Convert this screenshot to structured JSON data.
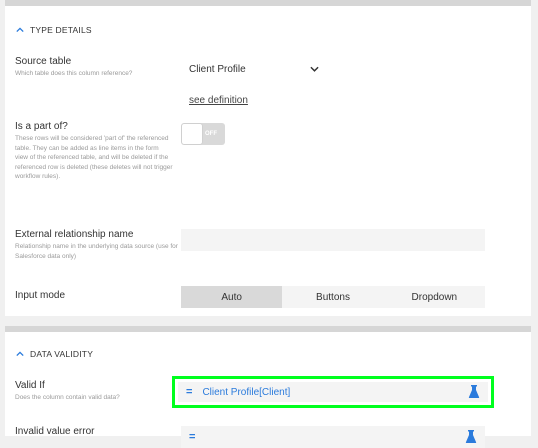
{
  "type_details": {
    "header": "TYPE DETAILS",
    "source_table": {
      "label": "Source table",
      "help": "Which table does this column reference?",
      "value": "Client Profile",
      "link": "see definition"
    },
    "is_part_of": {
      "label": "Is a part of?",
      "help": "These rows will be considered 'part of' the referenced table. They can be added as line items in the form view of the referenced table, and will be deleted if the referenced row is deleted (these deletes will not trigger workflow rules).",
      "toggle_text": "OFF"
    },
    "external_rel": {
      "label": "External relationship name",
      "help": "Relationship name in the underlying data source (use for Salesforce data only)",
      "value": ""
    },
    "input_mode": {
      "label": "Input mode",
      "options": [
        "Auto",
        "Buttons",
        "Dropdown"
      ],
      "selected": "Auto"
    }
  },
  "data_validity": {
    "header": "DATA VALIDITY",
    "valid_if": {
      "label": "Valid If",
      "help": "Does the column contain valid data?",
      "prefix": "=",
      "expression": "Client Profile[Client]",
      "icon": "flask-icon"
    },
    "invalid_error": {
      "label": "Invalid value error",
      "prefix": "="
    }
  },
  "colors": {
    "accent": "#2b7bdc",
    "highlight": "#00ff1e",
    "toggle_off": "#d9d9d9"
  }
}
